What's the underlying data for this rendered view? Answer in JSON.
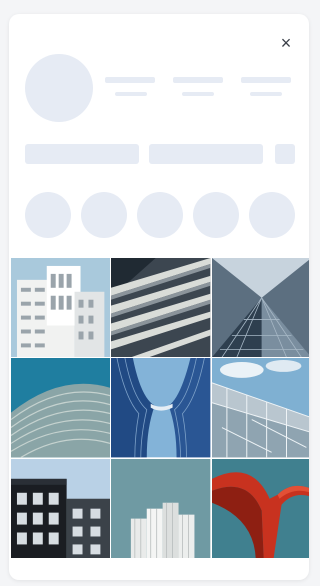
{
  "dialog": {
    "close_icon": "close-icon",
    "close_glyph": "×"
  },
  "gallery": {
    "tiles": [
      {
        "icon": "photo-white-building"
      },
      {
        "icon": "photo-striped-facade"
      },
      {
        "icon": "photo-glass-tower-up"
      },
      {
        "icon": "photo-teal-wave-facade"
      },
      {
        "icon": "photo-curved-blue-towers"
      },
      {
        "icon": "photo-glass-facade-sky"
      },
      {
        "icon": "photo-black-apartments"
      },
      {
        "icon": "photo-white-stepped-building"
      },
      {
        "icon": "photo-red-sculpture"
      }
    ]
  },
  "colors": {
    "skeleton": "#e6ebf4",
    "background": "#ffffff"
  }
}
